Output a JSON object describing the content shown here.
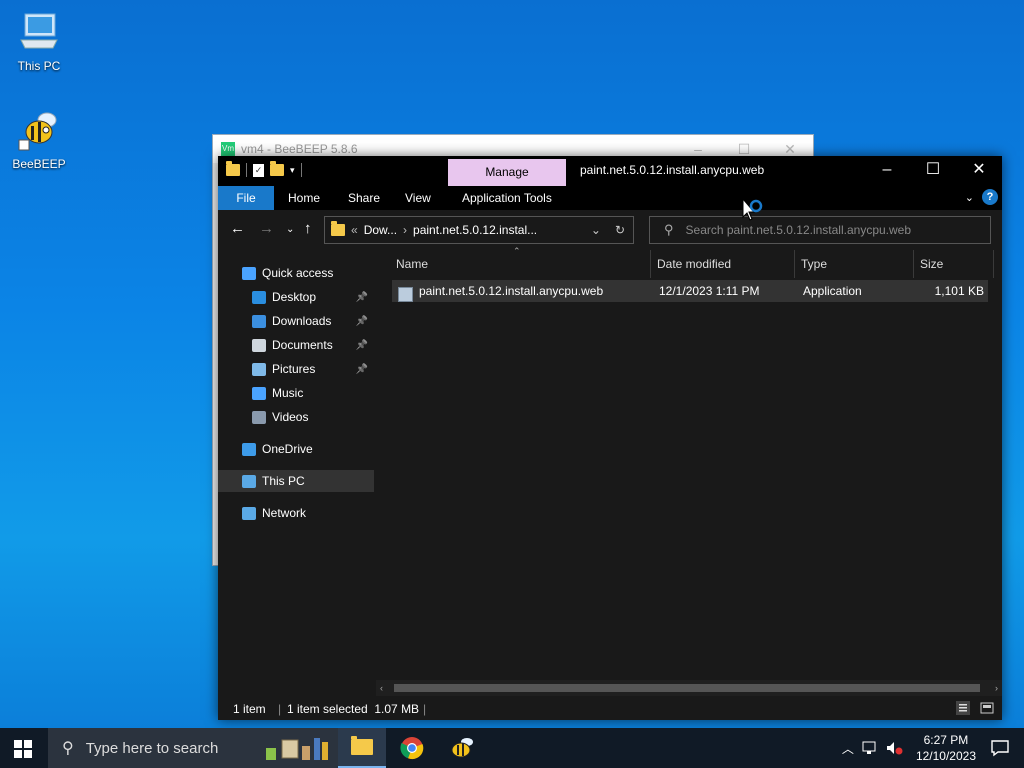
{
  "desktop": {
    "icons": [
      {
        "label": "This PC"
      },
      {
        "label": "BeeBEEP"
      }
    ]
  },
  "background_window": {
    "title": "vm4 - BeeBEEP 5.8.6",
    "app_badge": "Vm"
  },
  "explorer": {
    "title": "paint.net.5.0.12.install.anycpu.web",
    "ribbon": {
      "manage_label": "Manage",
      "tabs": [
        "File",
        "Home",
        "Share",
        "View",
        "Application Tools"
      ],
      "help_label": "?"
    },
    "address": {
      "prefix": "«",
      "crumbs": [
        "Dow...",
        "paint.net.5.0.12.instal..."
      ]
    },
    "search": {
      "placeholder": "Search paint.net.5.0.12.install.anycpu.web"
    },
    "nav": {
      "items": [
        {
          "label": "Quick access",
          "color": "#4aa3ff"
        },
        {
          "label": "Desktop",
          "color": "#2a8ee0",
          "pinned": true
        },
        {
          "label": "Downloads",
          "color": "#3b8fe0",
          "pinned": true
        },
        {
          "label": "Documents",
          "color": "#cfd6dd",
          "pinned": true
        },
        {
          "label": "Pictures",
          "color": "#7fb9e8",
          "pinned": true
        },
        {
          "label": "Music",
          "color": "#4aa3ff"
        },
        {
          "label": "Videos",
          "color": "#8a9aad"
        },
        {
          "label": "OneDrive",
          "color": "#3d9be9"
        },
        {
          "label": "This PC",
          "color": "#5aa9e6",
          "selected": true
        },
        {
          "label": "Network",
          "color": "#5aa9e6"
        }
      ]
    },
    "columns": [
      "Name",
      "Date modified",
      "Type",
      "Size"
    ],
    "files": [
      {
        "name": "paint.net.5.0.12.install.anycpu.web",
        "date": "12/1/2023 1:11 PM",
        "type": "Application",
        "size": "1,101 KB"
      }
    ],
    "status": {
      "count": "1 item",
      "selection": "1 item selected  1.07 MB"
    }
  },
  "taskbar": {
    "search_placeholder": "Type here to search",
    "apps": [
      "file-explorer",
      "chrome",
      "beebeep"
    ],
    "clock": {
      "time": "6:27 PM",
      "date": "12/10/2023"
    }
  },
  "colors": {
    "accent": "#1979ca",
    "manage_tab": "#e8c6ee",
    "explorer_bg": "#191919"
  }
}
